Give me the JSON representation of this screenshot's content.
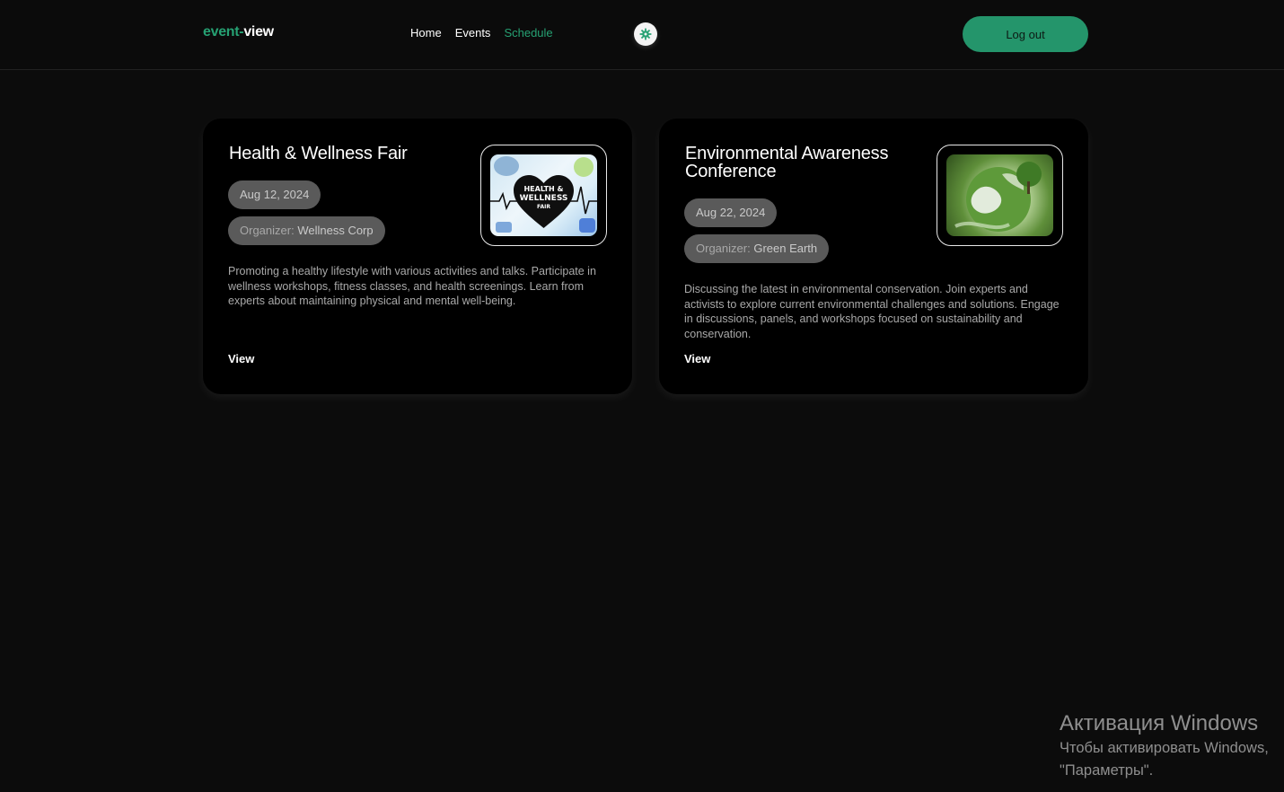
{
  "header": {
    "logo_part1": "event-",
    "logo_part2": "view",
    "nav": [
      "Home",
      "Events",
      "Schedule"
    ],
    "active_nav": "Schedule",
    "theme_icon": "gear-icon",
    "logout_label": "Log out"
  },
  "colors": {
    "accent": "#26a173",
    "background": "#0c0c0c",
    "card": "#000000",
    "pill": "#5a5a5a"
  },
  "events": [
    {
      "title": "Health & Wellness Fair",
      "date": "Aug 12, 2024",
      "organizer_label": "Organizer:",
      "organizer": "Wellness Corp",
      "image_text": [
        "HEALTH &",
        "WELLNESS",
        "FAIR"
      ],
      "description": "Promoting a healthy lifestyle with various activities and talks. Participate in wellness workshops, fitness classes, and health screenings. Learn from experts about maintaining physical and mental well-being.",
      "view_label": "View"
    },
    {
      "title": "Environmental Awareness Conference",
      "date": "Aug 22, 2024",
      "organizer_label": "Organizer:",
      "organizer": "Green Earth",
      "description": "Discussing the latest in environmental conservation. Join experts and activists to explore current environmental challenges and solutions. Engage in discussions, panels, and workshops focused on sustainability and conservation.",
      "view_label": "View"
    }
  ],
  "watermark": {
    "title": "Активация Windows",
    "line1": "Чтобы активировать Windows,",
    "line2": "\"Параметры\"."
  }
}
